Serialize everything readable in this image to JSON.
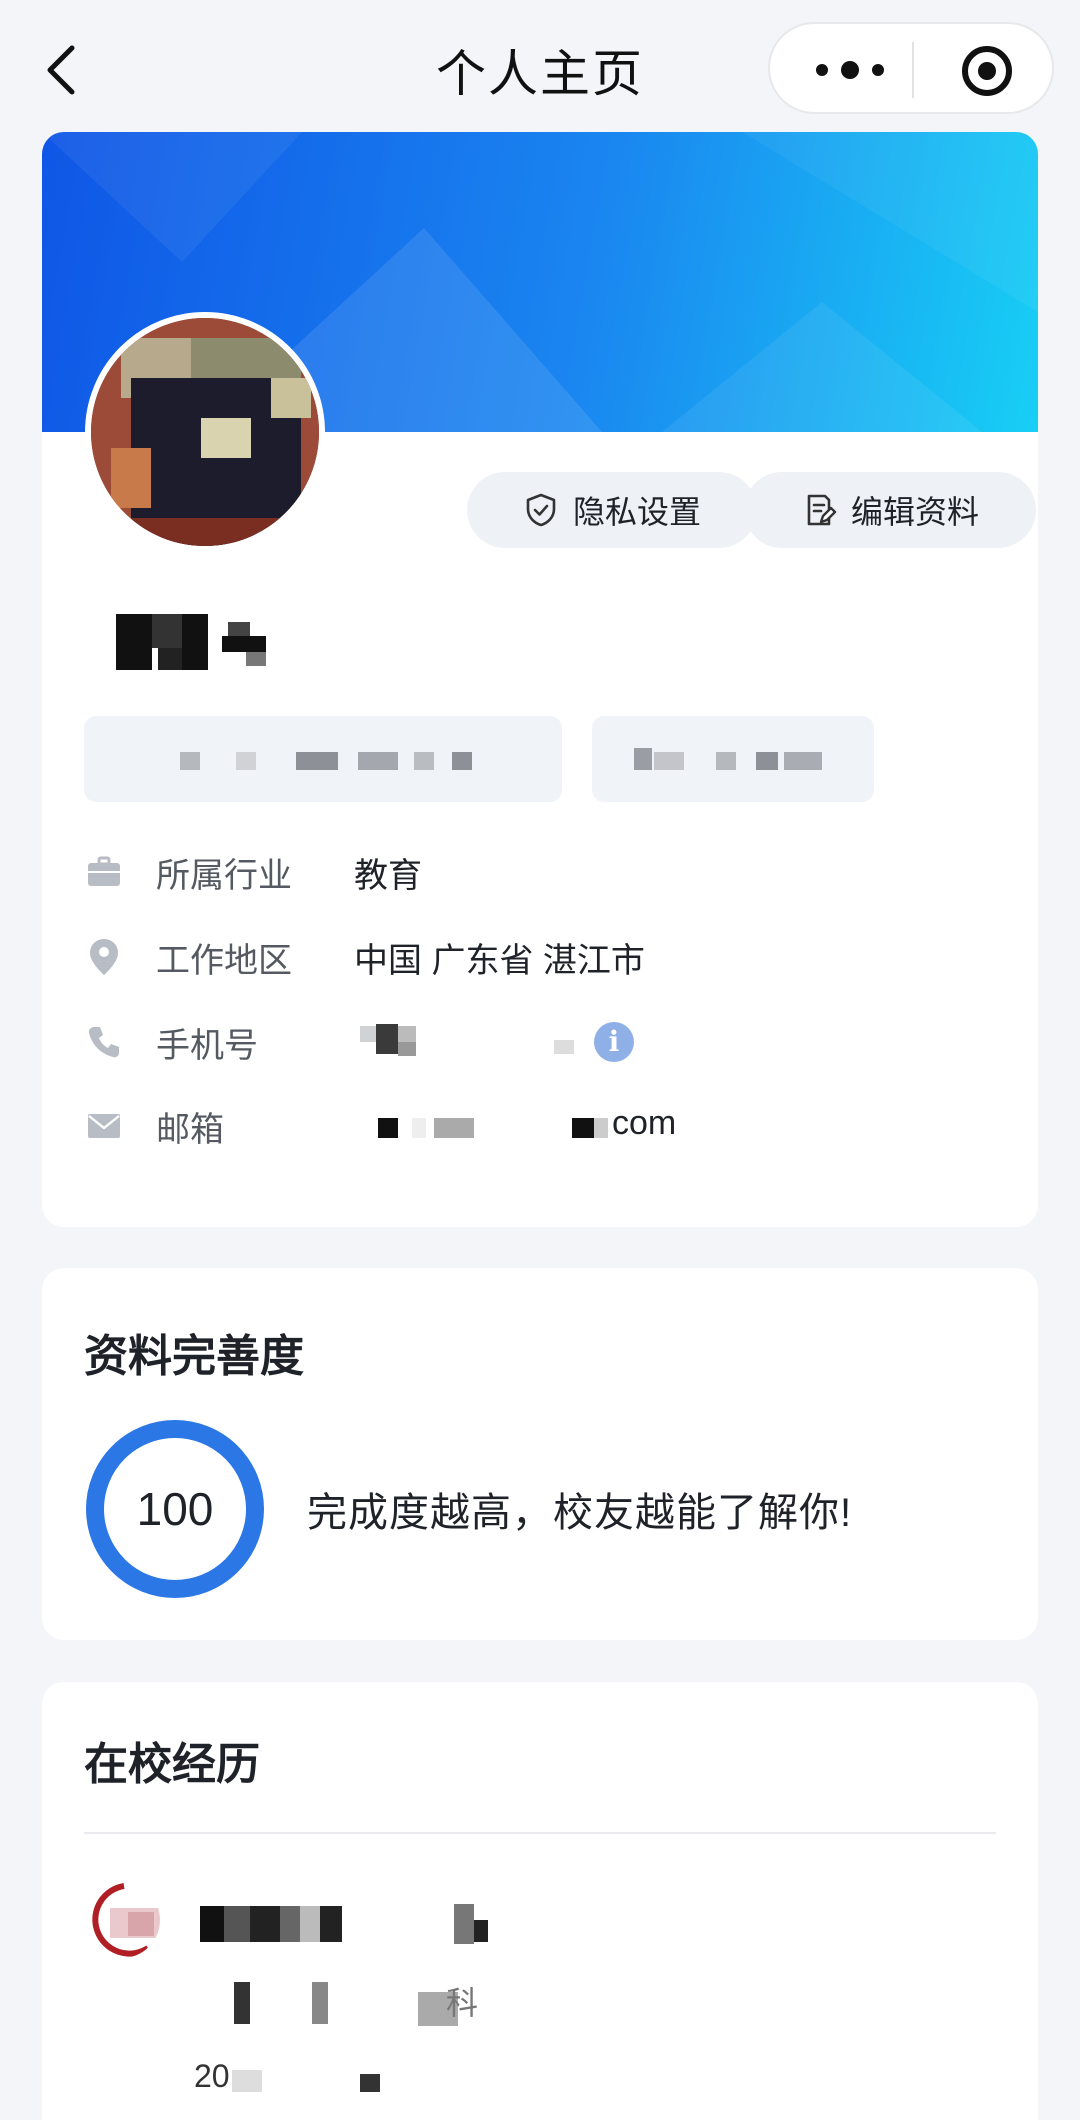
{
  "nav": {
    "title": "个人主页"
  },
  "profile": {
    "actions": {
      "privacy_label": "隐私设置",
      "edit_label": "编辑资料"
    },
    "info": [
      {
        "label": "所属行业",
        "value": "教育",
        "icon": "briefcase-icon"
      },
      {
        "label": "工作地区",
        "value": "中国 广东省 湛江市",
        "icon": "location-pin-icon"
      },
      {
        "label": "手机号",
        "value": "",
        "icon": "phone-icon"
      },
      {
        "label": "邮箱",
        "value": "com",
        "icon": "mail-icon"
      }
    ]
  },
  "completeness": {
    "title": "资料完善度",
    "score": "100",
    "tip": "完成度越高，校友越能了解你!"
  },
  "school": {
    "title": "在校经历",
    "subject_suffix": "科",
    "year_prefix": "20"
  },
  "colors": {
    "accent": "#2b77e5",
    "banner_start": "#0f56e6",
    "banner_end": "#18cff5",
    "page_bg": "#f3f5f8"
  }
}
